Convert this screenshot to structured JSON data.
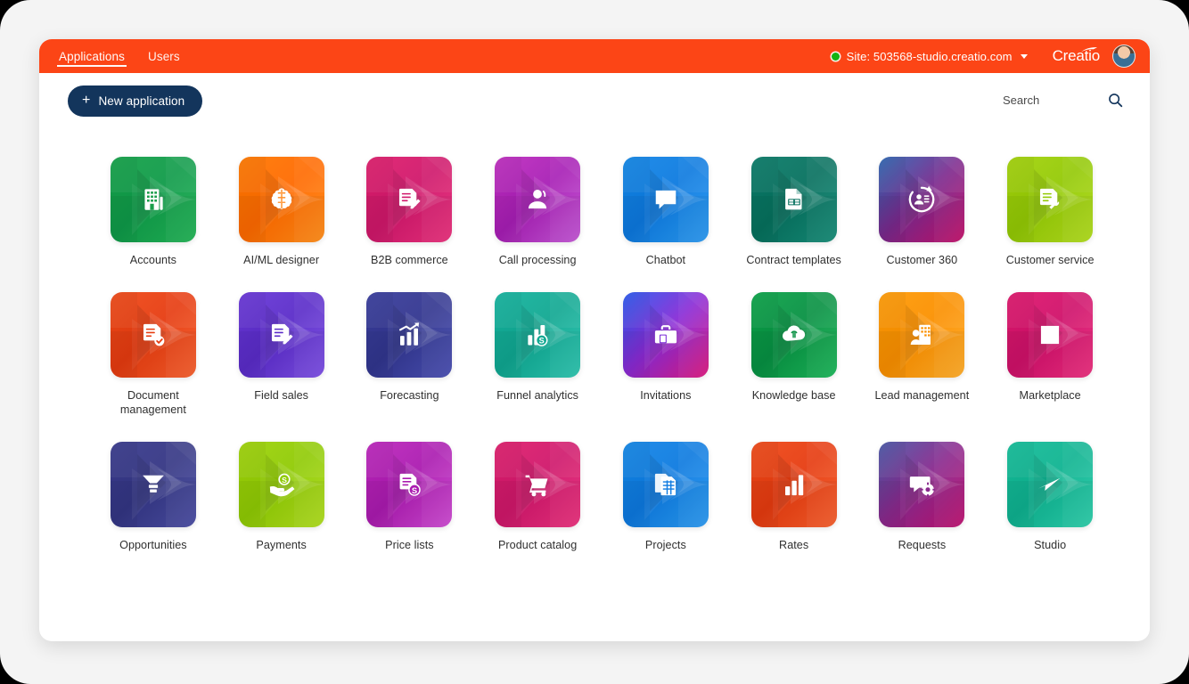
{
  "header": {
    "tabs": [
      {
        "label": "Applications",
        "active": true
      },
      {
        "label": "Users",
        "active": false
      }
    ],
    "site_label": "Site: 503568-studio.creatio.com",
    "status_color": "#12b312",
    "brand": "Creatio",
    "bar_color": "#fc4516",
    "avatar_name": "user-avatar"
  },
  "toolbar": {
    "new_application_label": "New application",
    "new_application_plus": "+",
    "new_application_color": "#13355c",
    "search_placeholder": "Search",
    "search_value": ""
  },
  "apps": [
    {
      "label": "Accounts",
      "icon": "building-grid-icon",
      "c1": "#17a24a",
      "c2": "#0f9b4a",
      "c3": "#22b455"
    },
    {
      "label": "AI/ML designer",
      "icon": "brain-icon",
      "c1": "#ff7a00",
      "c2": "#ff6a00",
      "c3": "#ff8c16"
    },
    {
      "label": "B2B commerce",
      "icon": "document-edit-icon",
      "c1": "#e01f6e",
      "c2": "#d0186b",
      "c3": "#ea2f7c"
    },
    {
      "label": "Call processing",
      "icon": "headset-agent-icon",
      "c1": "#c02fc0",
      "c2": "#a81fb6",
      "c3": "#c457d6"
    },
    {
      "label": "Chatbot",
      "icon": "chat-bubble-icon",
      "c1": "#1488e8",
      "c2": "#0d7ae0",
      "c3": "#2c9bf2"
    },
    {
      "label": "Contract templates",
      "icon": "document-table-icon",
      "c1": "#0b7d6a",
      "c2": "#07715f",
      "c3": "#158c77"
    },
    {
      "label": "Customer 360",
      "icon": "customer-refresh-icon",
      "c1": "#2f6ab5",
      "c2": "#7a2a8e",
      "c3": "#c5106a"
    },
    {
      "label": "Customer service",
      "icon": "document-wrench-icon",
      "c1": "#a4d40b",
      "c2": "#94ca06",
      "c3": "#b2dd1c"
    },
    {
      "label": "Document management",
      "icon": "document-check-icon",
      "c1": "#f04a1a",
      "c2": "#e63c10",
      "c3": "#f75e2c"
    },
    {
      "label": "Field sales",
      "icon": "document-pen-icon",
      "c1": "#6a39d9",
      "c2": "#5b2cc9",
      "c3": "#7d50e6"
    },
    {
      "label": "Forecasting",
      "icon": "bar-chart-trend-icon",
      "c1": "#3b3f9e",
      "c2": "#32368f",
      "c3": "#4a50b4"
    },
    {
      "label": "Funnel analytics",
      "icon": "chart-money-icon",
      "c1": "#17b5a0",
      "c2": "#10a892",
      "c3": "#2cc5b0"
    },
    {
      "label": "Invitations",
      "icon": "briefcase-icon",
      "c1": "#2a5cf0",
      "c2": "#8a2bd6",
      "c3": "#e0197e"
    },
    {
      "label": "Knowledge base",
      "icon": "cloud-bulb-icon",
      "c1": "#0da54a",
      "c2": "#089143",
      "c3": "#1cb85a"
    },
    {
      "label": "Lead management",
      "icon": "person-building-icon",
      "c1": "#ff9d08",
      "c2": "#fb9000",
      "c3": "#ffac28"
    },
    {
      "label": "Marketplace",
      "icon": "white-square-icon",
      "c1": "#e0196e",
      "c2": "#d0116a",
      "c3": "#ec2d7e"
    },
    {
      "label": "Opportunities",
      "icon": "funnel-icon",
      "c1": "#3b3c8e",
      "c2": "#343684",
      "c3": "#4a4da3"
    },
    {
      "label": "Payments",
      "icon": "hand-coin-icon",
      "c1": "#a0d40a",
      "c2": "#90cb05",
      "c3": "#b0de1e"
    },
    {
      "label": "Price lists",
      "icon": "price-document-icon",
      "c1": "#be28be",
      "c2": "#ab1bb0",
      "c3": "#cf4ad3"
    },
    {
      "label": "Product catalog",
      "icon": "shopping-cart-icon",
      "c1": "#e01f6e",
      "c2": "#d0186b",
      "c3": "#ea2f7c"
    },
    {
      "label": "Projects",
      "icon": "project-sheet-icon",
      "c1": "#1488e8",
      "c2": "#0d7ae0",
      "c3": "#2c9bf2"
    },
    {
      "label": "Rates",
      "icon": "bar-chart-icon",
      "c1": "#f04a1a",
      "c2": "#e63c10",
      "c3": "#f75e2c"
    },
    {
      "label": "Requests",
      "icon": "ticket-gear-icon",
      "c1": "#4a5aa8",
      "c2": "#8a2a8e",
      "c3": "#c01070"
    },
    {
      "label": "Studio",
      "icon": "studio-arrow-icon",
      "c1": "#16bf9b",
      "c2": "#0fb391",
      "c3": "#2ccfab"
    }
  ]
}
